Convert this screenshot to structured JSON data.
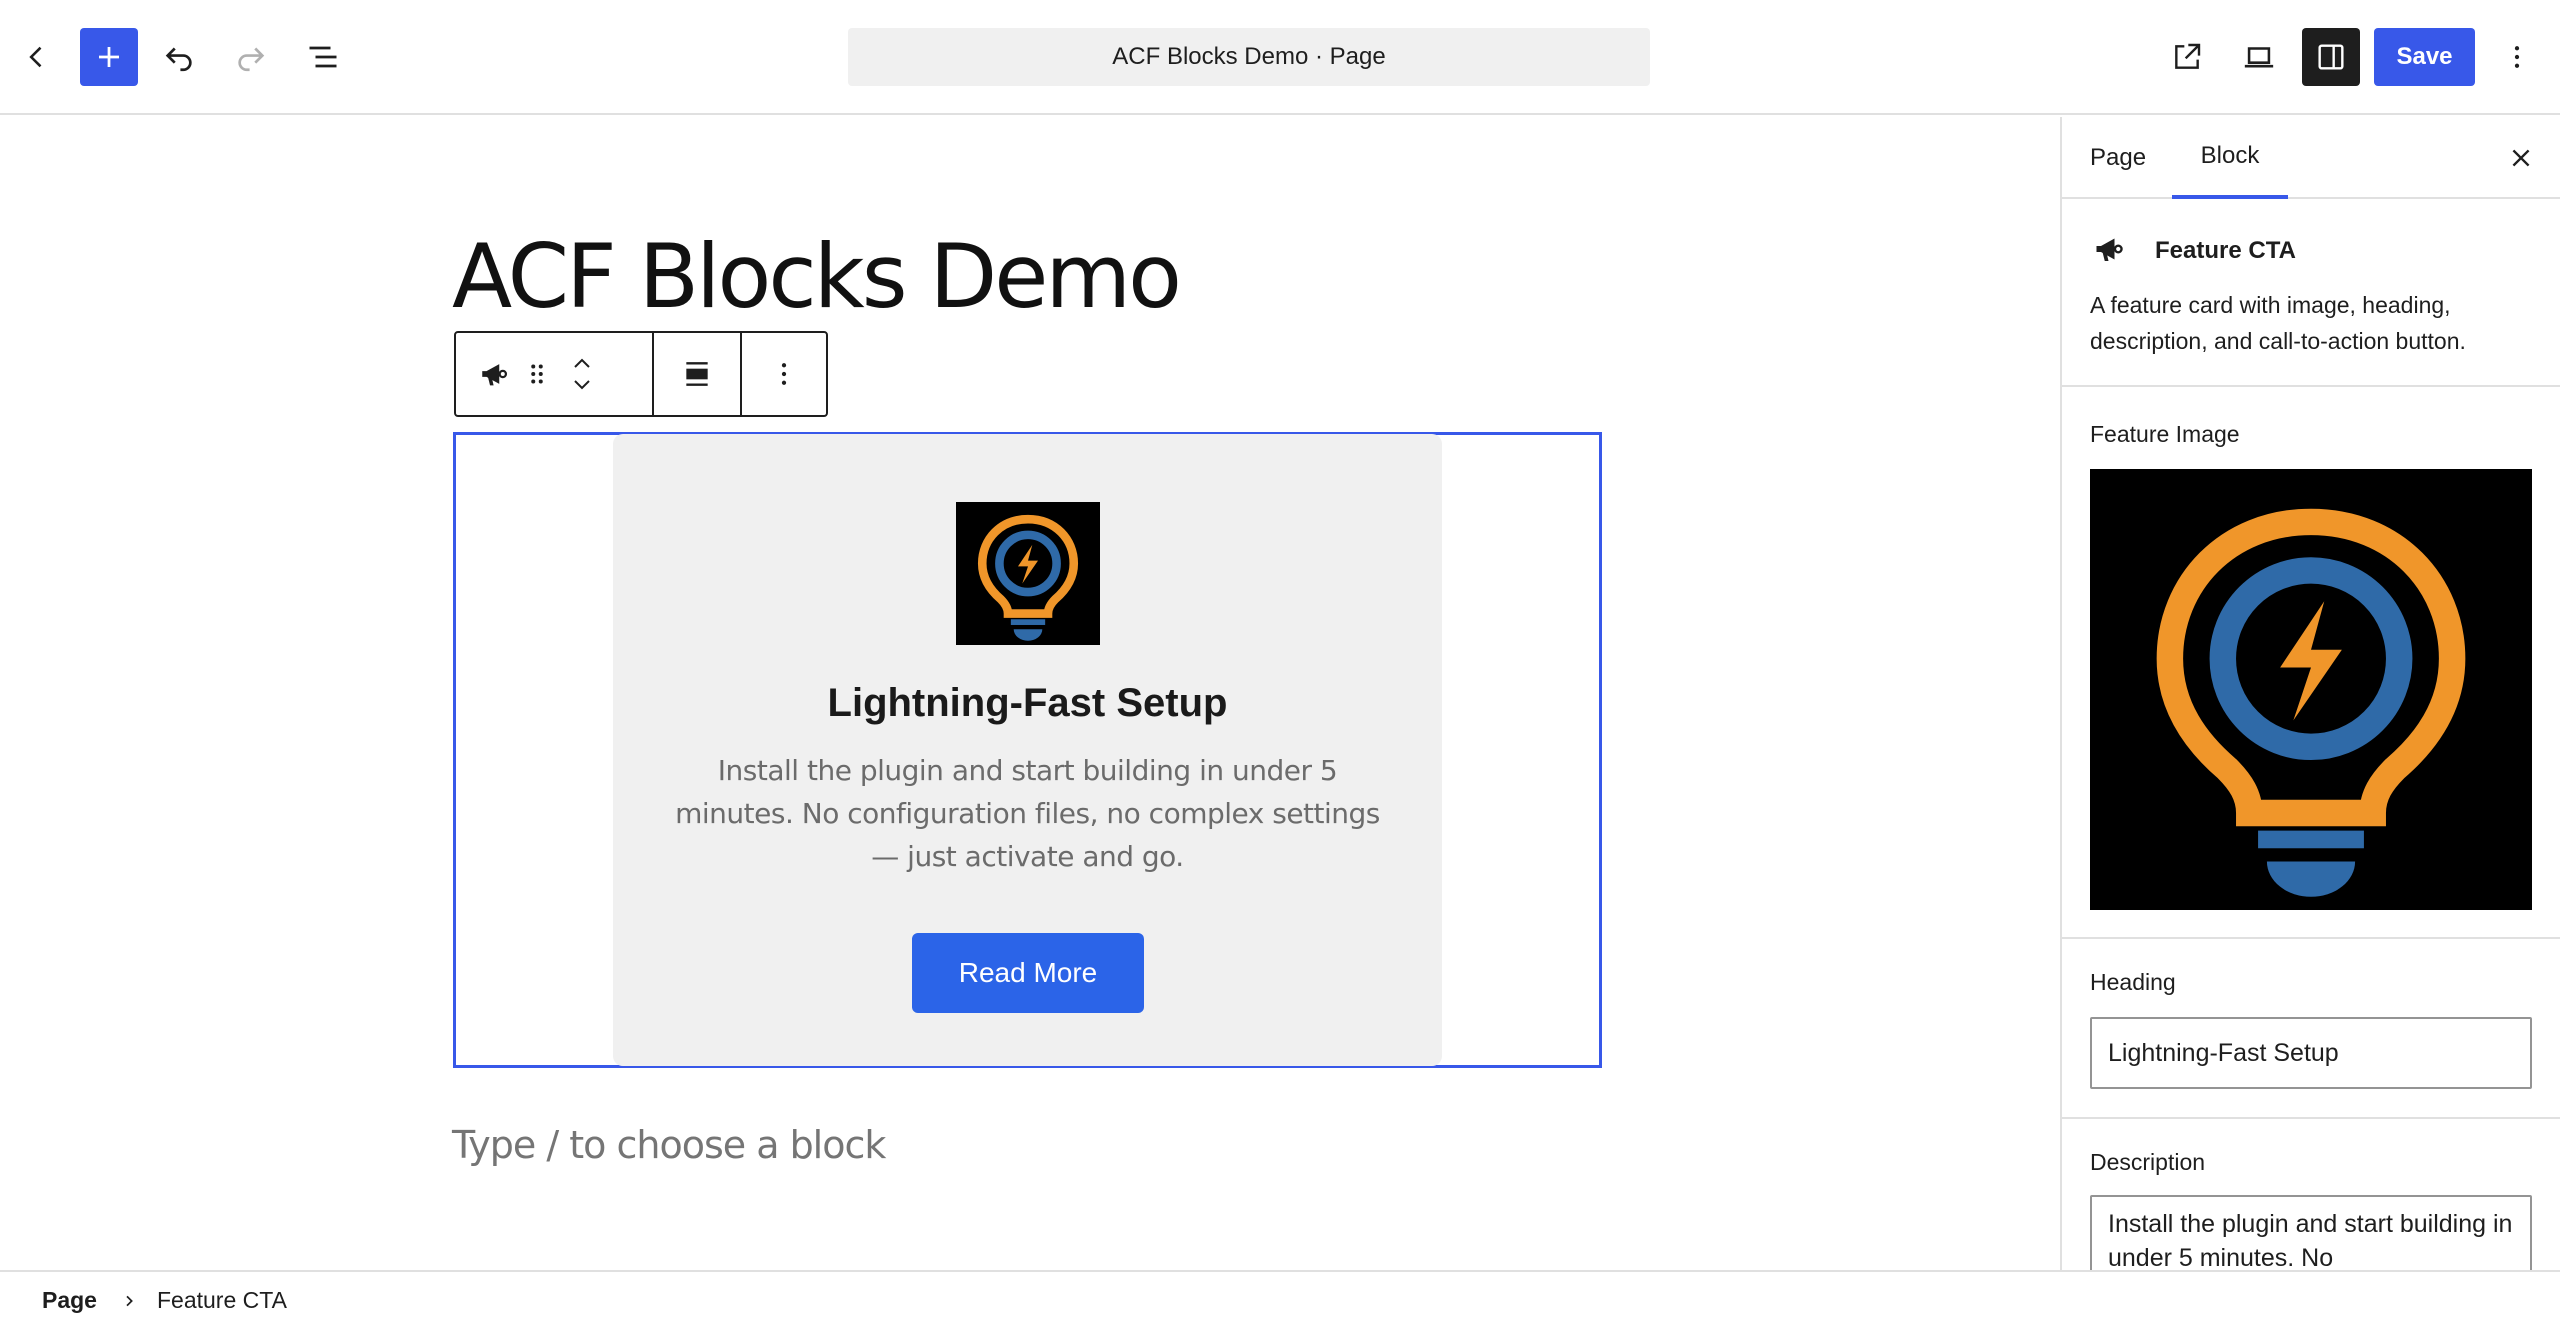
{
  "header": {
    "document_title": "ACF Blocks Demo · Page",
    "save_label": "Save",
    "icons": [
      "back-chevron-icon",
      "plus-icon",
      "undo-icon",
      "redo-icon",
      "list-view-icon",
      "external-link-icon",
      "laptop-icon",
      "sidebar-icon",
      "more-vertical-icon"
    ]
  },
  "canvas": {
    "page_title": "ACF Blocks Demo",
    "block_toolbar": {
      "icons": [
        "megaphone-icon",
        "drag-handle-icon",
        "move-up-icon",
        "move-down-icon",
        "align-icon",
        "more-vertical-icon"
      ]
    },
    "card": {
      "heading": "Lightning-Fast Setup",
      "description": "Install the plugin and start building in under 5 minutes. No configuration files, no complex settings — just activate and go.",
      "button_label": "Read More"
    },
    "placeholder": "Type / to choose a block"
  },
  "sidebar": {
    "tabs": [
      {
        "label": "Page",
        "active": false
      },
      {
        "label": "Block",
        "active": true
      }
    ],
    "block_card": {
      "title": "Feature CTA",
      "description": "A feature card with image, heading, description, and call-to-action button."
    },
    "fields": {
      "image_label": "Feature Image",
      "heading_label": "Heading",
      "heading_value": "Lightning-Fast Setup",
      "description_label": "Description",
      "description_value": "Install the plugin and start building in under 5 minutes. No"
    }
  },
  "footer": {
    "breadcrumb": [
      "Page",
      "Feature CTA"
    ]
  },
  "colors": {
    "accent": "#3858e9",
    "card_button": "#2b64e8",
    "bulb_orange": "#f0962a",
    "bulb_blue": "#2f6aa8",
    "card_bg": "#f0f0f0"
  }
}
